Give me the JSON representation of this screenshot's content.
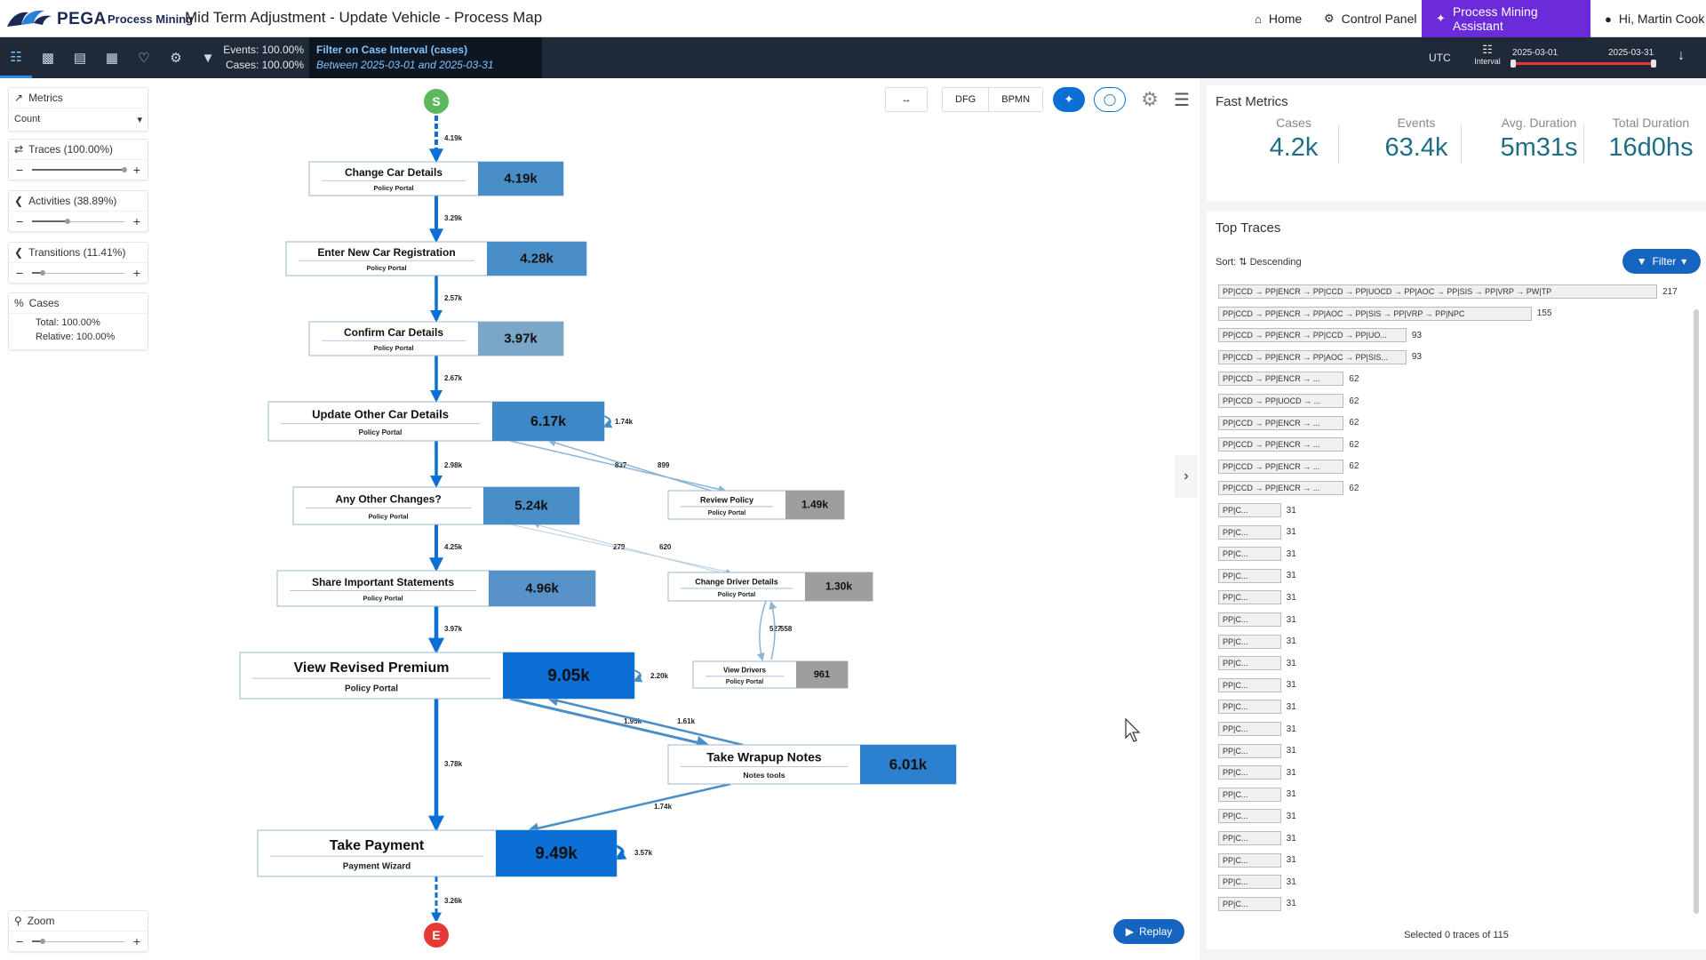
{
  "header": {
    "brand": "PEGA",
    "brand_sub": "Process Mining",
    "page_title": "Mid Term Adjustment - Update Vehicle - Process Map",
    "nav": {
      "home": "Home",
      "control_panel": "Control Panel",
      "assistant": "Process Mining Assistant",
      "user": "Hi, Martin Cook"
    }
  },
  "toolbar": {
    "events_stat": "Events: 100.00%",
    "cases_stat": "Cases: 100.00%",
    "filter_title": "Filter on Case Interval (cases)",
    "filter_desc": "Between 2025-03-01 and 2025-03-31",
    "timezone": "UTC",
    "interval_label": "Interval",
    "date_from": "2025-03-01",
    "date_to": "2025-03-31",
    "icons": [
      "process-map-icon",
      "case-search-icon",
      "chart-icon",
      "table-icon",
      "bell-icon",
      "variants-icon",
      "filter-icon"
    ]
  },
  "left_panel": {
    "metrics": {
      "label": "Metrics",
      "value": "Count"
    },
    "traces": {
      "label": "Traces (100.00%)",
      "level": 1.0
    },
    "activities": {
      "label": "Activities (38.89%)",
      "level": 0.3889
    },
    "transitions": {
      "label": "Transitions (11.41%)",
      "level": 0.1141
    },
    "cases": {
      "label": "Cases",
      "total": "Total: 100.00%",
      "relative": "Relative: 100.00%"
    },
    "zoom": {
      "label": "Zoom",
      "level": 0.12
    }
  },
  "map": {
    "start_label": "S",
    "end_label": "E",
    "view_buttons": {
      "dfg": "DFG",
      "bpmn": "BPMN"
    },
    "replay_label": "Replay",
    "nodes": [
      {
        "id": "ccd",
        "name": "Change Car Details",
        "app": "Policy Portal",
        "count": "4.19k"
      },
      {
        "id": "encr",
        "name": "Enter New Car Registration",
        "app": "Policy Portal",
        "count": "4.28k"
      },
      {
        "id": "confirm",
        "name": "Confirm Car Details",
        "app": "Policy Portal",
        "count": "3.97k"
      },
      {
        "id": "uocd",
        "name": "Update Other Car Details",
        "app": "Policy Portal",
        "count": "6.17k"
      },
      {
        "id": "aoc",
        "name": "Any Other Changes?",
        "app": "Policy Portal",
        "count": "5.24k"
      },
      {
        "id": "sis",
        "name": "Share Important Statements",
        "app": "Policy Portal",
        "count": "4.96k"
      },
      {
        "id": "vrp",
        "name": "View Revised Premium",
        "app": "Policy Portal",
        "count": "9.05k"
      },
      {
        "id": "twn",
        "name": "Take Wrapup Notes",
        "app": "Notes tools",
        "count": "6.01k"
      },
      {
        "id": "tp",
        "name": "Take Payment",
        "app": "Payment Wizard",
        "count": "9.49k"
      },
      {
        "id": "rp",
        "name": "Review Policy",
        "app": "Policy Portal",
        "count": "1.49k"
      },
      {
        "id": "cdd",
        "name": "Change Driver Details",
        "app": "Policy Portal",
        "count": "1.30k"
      },
      {
        "id": "vd",
        "name": "View Drivers",
        "app": "Policy Portal",
        "count": "961"
      }
    ],
    "edges": [
      {
        "from": "start",
        "to": "ccd",
        "label": "4.19k"
      },
      {
        "from": "ccd",
        "to": "encr",
        "label": "3.29k"
      },
      {
        "from": "encr",
        "to": "confirm",
        "label": "2.57k"
      },
      {
        "from": "confirm",
        "to": "uocd",
        "label": "2.67k"
      },
      {
        "from": "uocd",
        "to": "uocd",
        "label": "1.74k"
      },
      {
        "from": "uocd",
        "to": "aoc",
        "label": "2.98k"
      },
      {
        "from": "uocd",
        "to": "rp",
        "label": "837"
      },
      {
        "from": "rp",
        "to": "uocd",
        "label": "899"
      },
      {
        "from": "aoc",
        "to": "sis",
        "label": "4.25k"
      },
      {
        "from": "aoc",
        "to": "cdd",
        "label": "279"
      },
      {
        "from": "cdd",
        "to": "aoc",
        "label": "620"
      },
      {
        "from": "cdd",
        "to": "vd",
        "label": "527"
      },
      {
        "from": "vd",
        "to": "cdd",
        "label": "558"
      },
      {
        "from": "sis",
        "to": "vrp",
        "label": "3.97k"
      },
      {
        "from": "vrp",
        "to": "vrp",
        "label": "2.20k"
      },
      {
        "from": "vrp",
        "to": "twn",
        "label": "1.95k"
      },
      {
        "from": "twn",
        "to": "vrp",
        "label": "1.61k"
      },
      {
        "from": "vrp",
        "to": "tp",
        "label": "3.78k"
      },
      {
        "from": "twn",
        "to": "tp",
        "label": "1.74k"
      },
      {
        "from": "tp",
        "to": "tp",
        "label": "3.57k"
      },
      {
        "from": "tp",
        "to": "end",
        "label": "3.26k"
      }
    ]
  },
  "fast_metrics": {
    "title": "Fast Metrics",
    "items": [
      {
        "label": "Cases",
        "value": "4.2k"
      },
      {
        "label": "Events",
        "value": "63.4k"
      },
      {
        "label": "Avg. Duration",
        "value": "5m31s"
      },
      {
        "label": "Total Duration",
        "value": "16d0hs"
      }
    ]
  },
  "top_traces": {
    "title": "Top Traces",
    "sort_label": "Sort:",
    "sort_value": "Descending",
    "filter_label": "Filter",
    "footer": "Selected 0 traces of 115",
    "traces": [
      {
        "text": "PP|CCD → PP|ENCR → PP|CCD → PP|UOCD → PP|AOC → PP|SIS → PP|VRP → PW|TP",
        "count": "217",
        "share": 1.0
      },
      {
        "text": "PP|CCD → PP|ENCR → PP|AOC → PP|SIS → PP|VRP → PP|NPC",
        "count": "155",
        "share": 0.714
      },
      {
        "text": "PP|CCD → PP|ENCR → PP|CCD → PP|UO...",
        "count": "93",
        "share": 0.429
      },
      {
        "text": "PP|CCD → PP|ENCR → PP|AOC → PP|SIS...",
        "count": "93",
        "share": 0.429
      },
      {
        "text": "PP|CCD → PP|ENCR → ...",
        "count": "62",
        "share": 0.286
      },
      {
        "text": "PP|CCD → PP|UOCD → ...",
        "count": "62",
        "share": 0.286
      },
      {
        "text": "PP|CCD → PP|ENCR → ...",
        "count": "62",
        "share": 0.286
      },
      {
        "text": "PP|CCD → PP|ENCR → ...",
        "count": "62",
        "share": 0.286
      },
      {
        "text": "PP|CCD → PP|ENCR → ...",
        "count": "62",
        "share": 0.286
      },
      {
        "text": "PP|CCD → PP|ENCR → ...",
        "count": "62",
        "share": 0.286
      },
      {
        "text": "PP|C...",
        "count": "31",
        "share": 0.143
      },
      {
        "text": "PP|C...",
        "count": "31",
        "share": 0.143
      },
      {
        "text": "PP|C...",
        "count": "31",
        "share": 0.143
      },
      {
        "text": "PP|C...",
        "count": "31",
        "share": 0.143
      },
      {
        "text": "PP|C...",
        "count": "31",
        "share": 0.143
      },
      {
        "text": "PP|C...",
        "count": "31",
        "share": 0.143
      },
      {
        "text": "PP|C...",
        "count": "31",
        "share": 0.143
      },
      {
        "text": "PP|C...",
        "count": "31",
        "share": 0.143
      },
      {
        "text": "PP|C...",
        "count": "31",
        "share": 0.143
      },
      {
        "text": "PP|C...",
        "count": "31",
        "share": 0.143
      },
      {
        "text": "PP|C...",
        "count": "31",
        "share": 0.143
      },
      {
        "text": "PP|C...",
        "count": "31",
        "share": 0.143
      },
      {
        "text": "PP|C...",
        "count": "31",
        "share": 0.143
      },
      {
        "text": "PP|C...",
        "count": "31",
        "share": 0.143
      },
      {
        "text": "PP|C...",
        "count": "31",
        "share": 0.143
      },
      {
        "text": "PP|C...",
        "count": "31",
        "share": 0.143
      },
      {
        "text": "PP|C...",
        "count": "31",
        "share": 0.143
      },
      {
        "text": "PP|C...",
        "count": "31",
        "share": 0.143
      },
      {
        "text": "PP|C...",
        "count": "31",
        "share": 0.143
      }
    ]
  },
  "colors": {
    "accent": "#1565c0",
    "assistant": "#6c2bd9",
    "toolbar": "#1f2937",
    "node_dark": "#0b6fd6",
    "node_mid": "#4a8ec8",
    "node_light": "#7aa6c8",
    "node_grey": "#9e9e9e",
    "metric_value": "#1f6e86"
  }
}
